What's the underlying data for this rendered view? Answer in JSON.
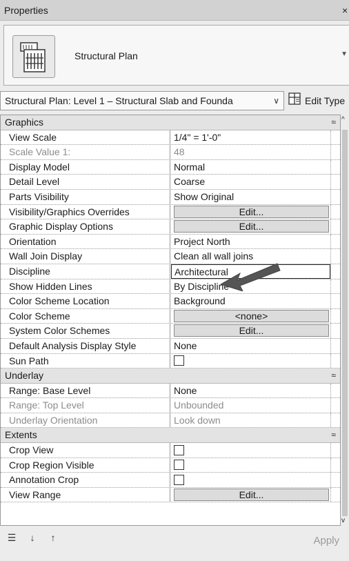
{
  "window": {
    "title": "Properties",
    "close_icon": "close-icon"
  },
  "type_selector": {
    "name": "Structural Plan",
    "icon": "structural-plan-icon"
  },
  "view_selector": {
    "value": "Structural Plan: Level 1 – Structural Slab and Founda",
    "edit_type_label": "Edit Type"
  },
  "groups": {
    "graphics": {
      "label": "Graphics",
      "rows": [
        {
          "name": "View Scale",
          "value": "1/4\" = 1'-0\""
        },
        {
          "name": "Scale Value    1:",
          "value": "48"
        },
        {
          "name": "Display Model",
          "value": "Normal"
        },
        {
          "name": "Detail Level",
          "value": "Coarse"
        },
        {
          "name": "Parts Visibility",
          "value": "Show Original"
        },
        {
          "name": "Visibility/Graphics Overrides",
          "value": "Edit..."
        },
        {
          "name": "Graphic Display Options",
          "value": "Edit..."
        },
        {
          "name": "Orientation",
          "value": "Project North"
        },
        {
          "name": "Wall Join Display",
          "value": "Clean all wall joins"
        },
        {
          "name": "Discipline",
          "value": "Architectural"
        },
        {
          "name": "Show Hidden Lines",
          "value": "By Discipline"
        },
        {
          "name": "Color Scheme Location",
          "value": "Background"
        },
        {
          "name": "Color Scheme",
          "value": "<none>"
        },
        {
          "name": "System Color Schemes",
          "value": "Edit..."
        },
        {
          "name": "Default Analysis Display Style",
          "value": "None"
        },
        {
          "name": "Sun Path",
          "value": ""
        }
      ]
    },
    "underlay": {
      "label": "Underlay",
      "rows": [
        {
          "name": "Range: Base Level",
          "value": "None"
        },
        {
          "name": "Range: Top Level",
          "value": "Unbounded"
        },
        {
          "name": "Underlay Orientation",
          "value": "Look down"
        }
      ]
    },
    "extents": {
      "label": "Extents",
      "rows": [
        {
          "name": "Crop View",
          "value": ""
        },
        {
          "name": "Crop Region Visible",
          "value": ""
        },
        {
          "name": "Annotation Crop",
          "value": ""
        },
        {
          "name": "View Range",
          "value": "Edit..."
        }
      ]
    }
  },
  "footer": {
    "apply_label": "Apply"
  }
}
